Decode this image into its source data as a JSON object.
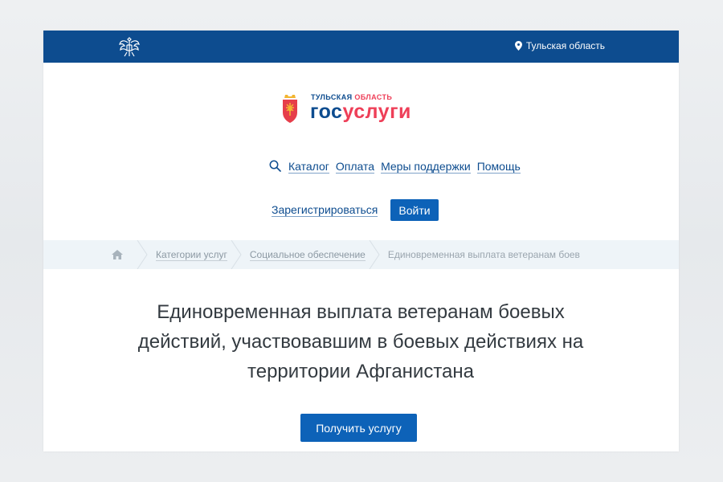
{
  "topbar": {
    "region_label": "Тульская область",
    "color": "#0d4c8f"
  },
  "logo": {
    "region_part1": "ТУЛЬСКАЯ ",
    "region_part2": "ОБЛАСТЬ",
    "gos": "гос",
    "uslugi": "услуги",
    "colors": {
      "blue": "#0d4c8f",
      "red": "#ee3f58"
    }
  },
  "nav": {
    "search_icon": "search-icon",
    "items": [
      {
        "label": "Каталог"
      },
      {
        "label": "Оплата"
      },
      {
        "label": "Меры поддержки"
      },
      {
        "label": "Помощь"
      }
    ]
  },
  "auth": {
    "register_label": "Зарегистрироваться",
    "login_label": "Войти"
  },
  "breadcrumb": {
    "home_icon": "home-icon",
    "items": [
      {
        "label": "Категории услуг"
      },
      {
        "label": "Социальное обеспечение"
      }
    ],
    "current": "Единовременная выплата ветеранам боев"
  },
  "service": {
    "title": "Единовременная выплата ветеранам боевых действий, участвовавшим в боевых действиях на территории Афганистана",
    "action_label": "Получить услугу",
    "accent": "#0d62b8"
  }
}
